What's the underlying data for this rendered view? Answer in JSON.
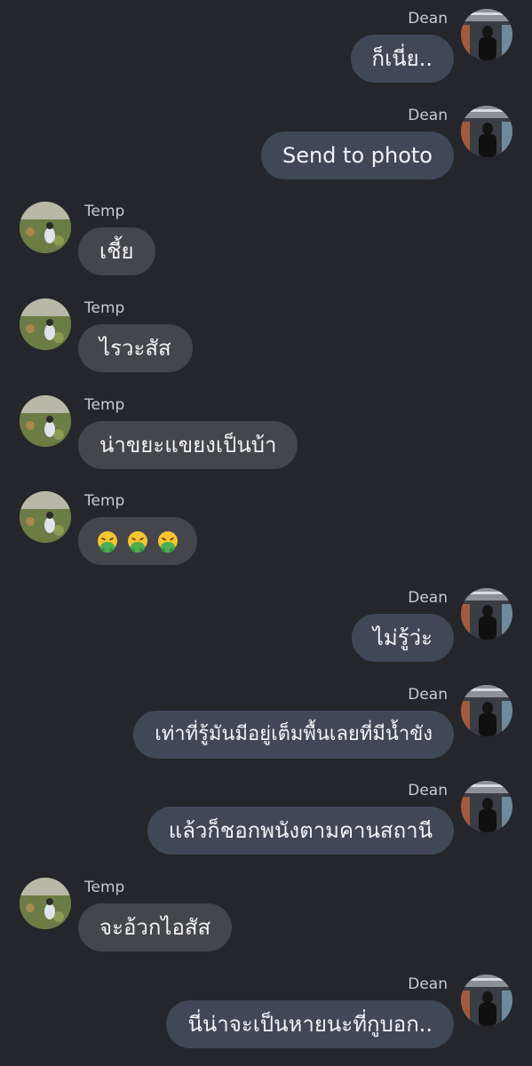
{
  "messages": [
    {
      "sender": "Dean",
      "side": "me",
      "text": "ก็เนี่ย.."
    },
    {
      "sender": "Dean",
      "side": "me",
      "text": "Send to photo"
    },
    {
      "sender": "Temp",
      "side": "them",
      "text": "เชี้ย"
    },
    {
      "sender": "Temp",
      "side": "them",
      "text": "ไรวะสัส"
    },
    {
      "sender": "Temp",
      "side": "them",
      "text": "น่าขยะแขยงเป็นบ้า"
    },
    {
      "sender": "Temp",
      "side": "them",
      "text": "🤮🤮🤮"
    },
    {
      "sender": "Dean",
      "side": "me",
      "text": "ไม่รู้ว่ะ"
    },
    {
      "sender": "Dean",
      "side": "me",
      "text": "เท่าที่รู้มันมีอยู่เต็มพื้นเลยที่มีน้ำขัง"
    },
    {
      "sender": "Dean",
      "side": "me",
      "text": "แล้วก็ชอกพนังตามคานสถานี"
    },
    {
      "sender": "Temp",
      "side": "them",
      "text": "จะอ้วกไอสัส"
    },
    {
      "sender": "Dean",
      "side": "me",
      "text": "นี่น่าจะเป็นหายนะที่กูบอก.."
    }
  ],
  "colors": {
    "background": "#25262b",
    "my_bubble": "#404858",
    "their_bubble": "#45464b",
    "name_text": "#c9cbd1"
  },
  "icons": {
    "vomit_emoji": "face-vomiting-icon",
    "dean_avatar": "dean-avatar-photo",
    "temp_avatar": "temp-avatar-photo"
  }
}
